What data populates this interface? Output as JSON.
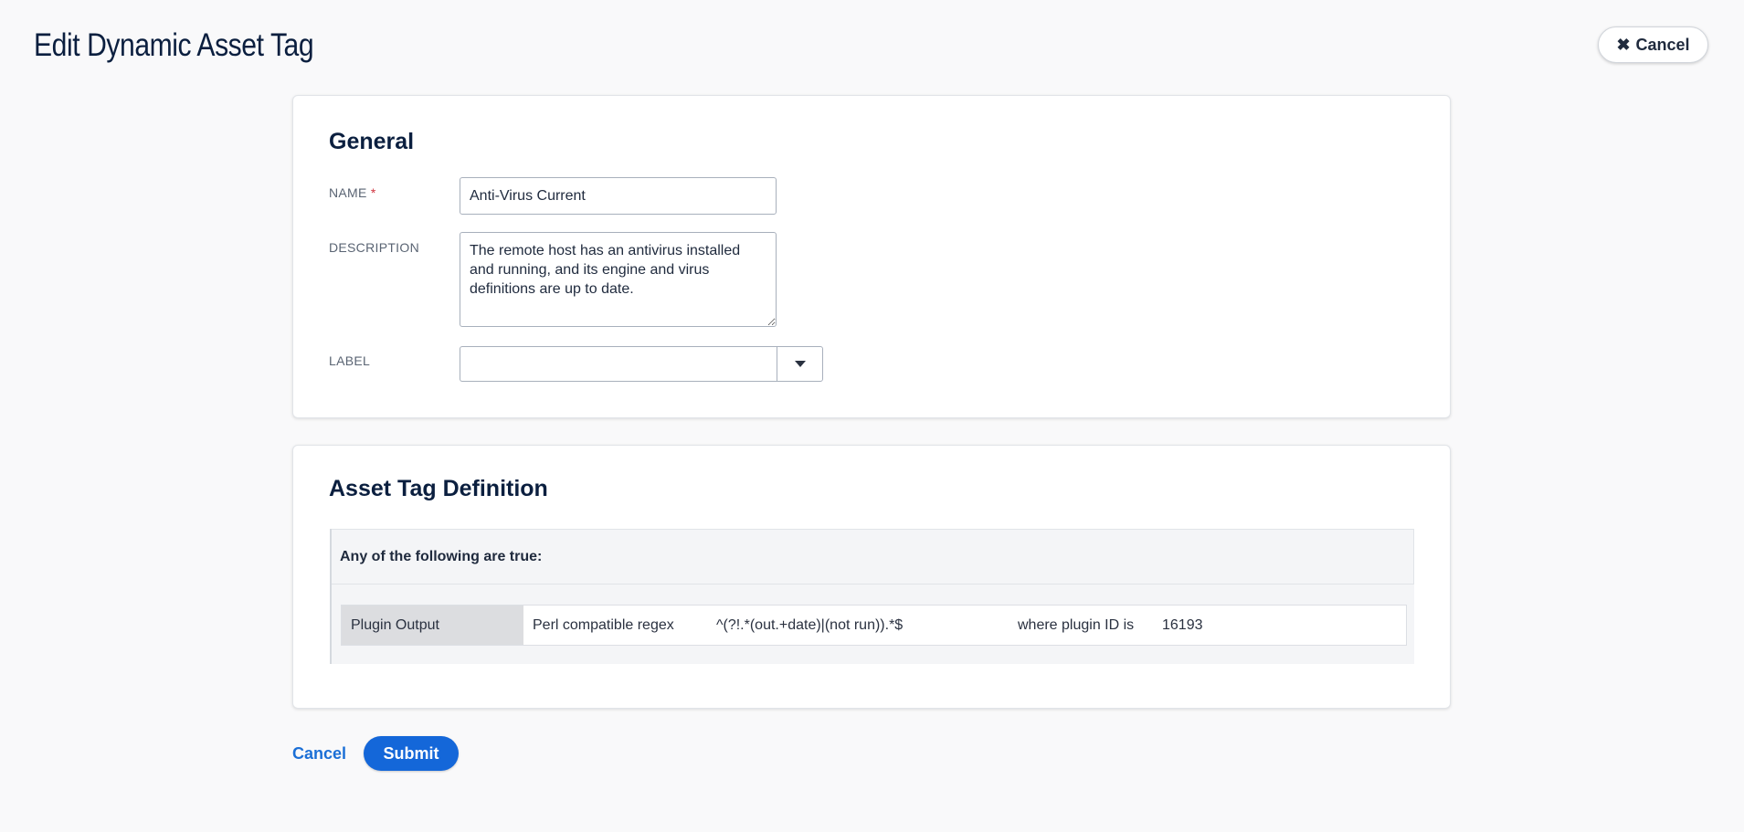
{
  "page": {
    "title": "Edit Dynamic Asset Tag",
    "cancel_label": "Cancel"
  },
  "general": {
    "heading": "General",
    "name_label": "NAME",
    "required_marker": "*",
    "name_value": "Anti-Virus Current",
    "description_label": "DESCRIPTION",
    "description_value": "The remote host has an antivirus installed and running, and its engine and virus definitions are up to date.",
    "label_label": "LABEL",
    "label_value": ""
  },
  "definition": {
    "heading": "Asset Tag Definition",
    "match_header": "Any of the following are true:",
    "rules": [
      {
        "category": "Plugin Output",
        "operator": "Perl compatible regex",
        "value": "^(?!.*(out.+date)|(not run)).*$",
        "qualifier": "where plugin ID is",
        "plugin_id": "16193"
      }
    ]
  },
  "footer": {
    "cancel_label": "Cancel",
    "submit_label": "Submit"
  },
  "colors": {
    "primary": "#1467d9",
    "link": "#1b6fd6",
    "heading": "#0b1f3f",
    "required": "#d0343f"
  }
}
